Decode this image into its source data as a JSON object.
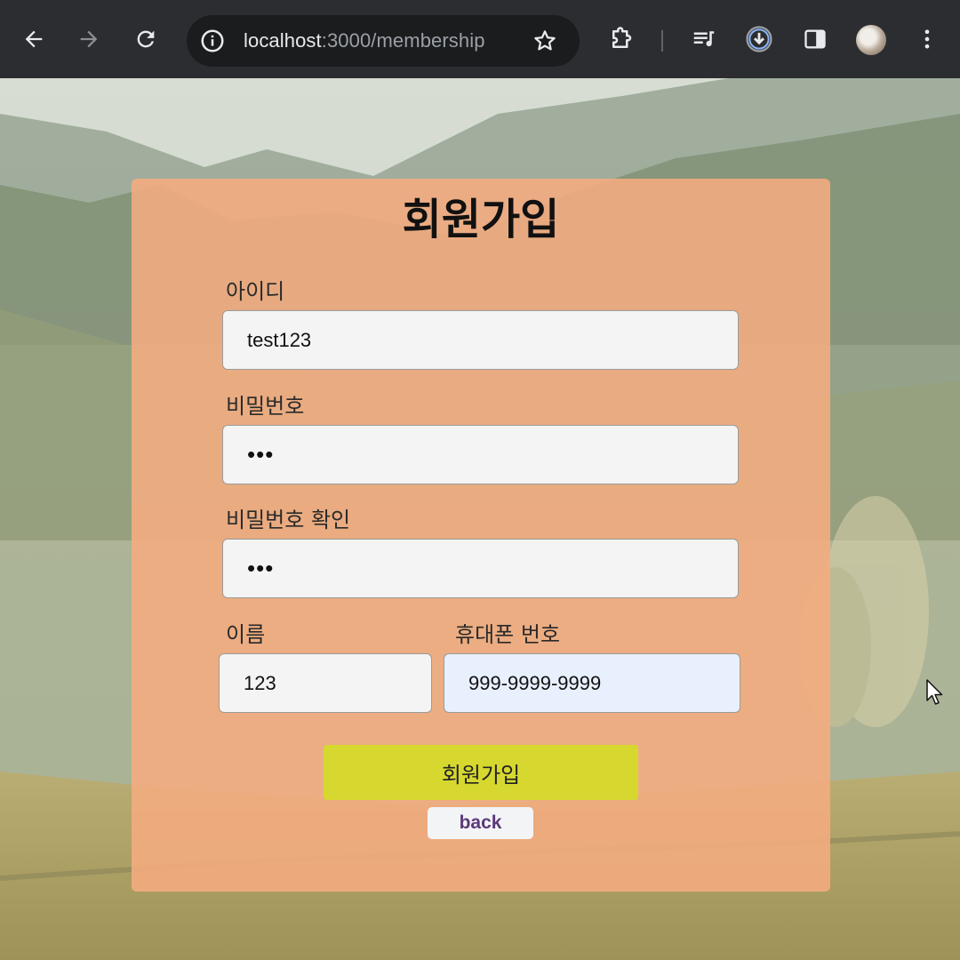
{
  "browser": {
    "url_host": "localhost",
    "url_rest": ":3000/membership"
  },
  "icons": {
    "back": "arrow-left-icon",
    "forward": "arrow-right-icon",
    "reload": "reload-icon",
    "site_info": "info-icon",
    "bookmark": "star-icon",
    "extensions": "puzzle-icon",
    "media": "media-playlist-icon",
    "downloads": "download-icon",
    "side_panel": "side-panel-icon",
    "menu": "kebab-menu-icon"
  },
  "form": {
    "title": "회원가입",
    "id_label": "아이디",
    "id_value": "test123",
    "password_label": "비밀번호",
    "password_value": "•••",
    "password_confirm_label": "비밀번호 확인",
    "password_confirm_value": "•••",
    "name_label": "이름",
    "name_value": "123",
    "phone_label": "휴대폰 번호",
    "phone_value": "999-9999-9999",
    "submit_label": "회원가입",
    "back_label": "back"
  },
  "colors": {
    "card": "#f5ac80",
    "submit": "#d6d830",
    "back_text": "#5b3a7a",
    "autofill": "#e8f0fe"
  }
}
